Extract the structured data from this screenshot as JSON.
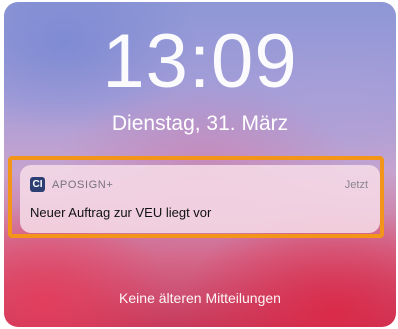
{
  "lockscreen": {
    "time": "13:09",
    "date": "Dienstag, 31. März"
  },
  "notification": {
    "app_icon_glyph": "CI",
    "app_name": "APOSIGN+",
    "timestamp": "Jetzt",
    "message": "Neuer Auftrag zur VEU liegt vor"
  },
  "footer": {
    "no_older_text": "Keine älteren Mitteilungen"
  },
  "colors": {
    "highlight": "#f29518",
    "app_icon": "#2c3e73"
  }
}
